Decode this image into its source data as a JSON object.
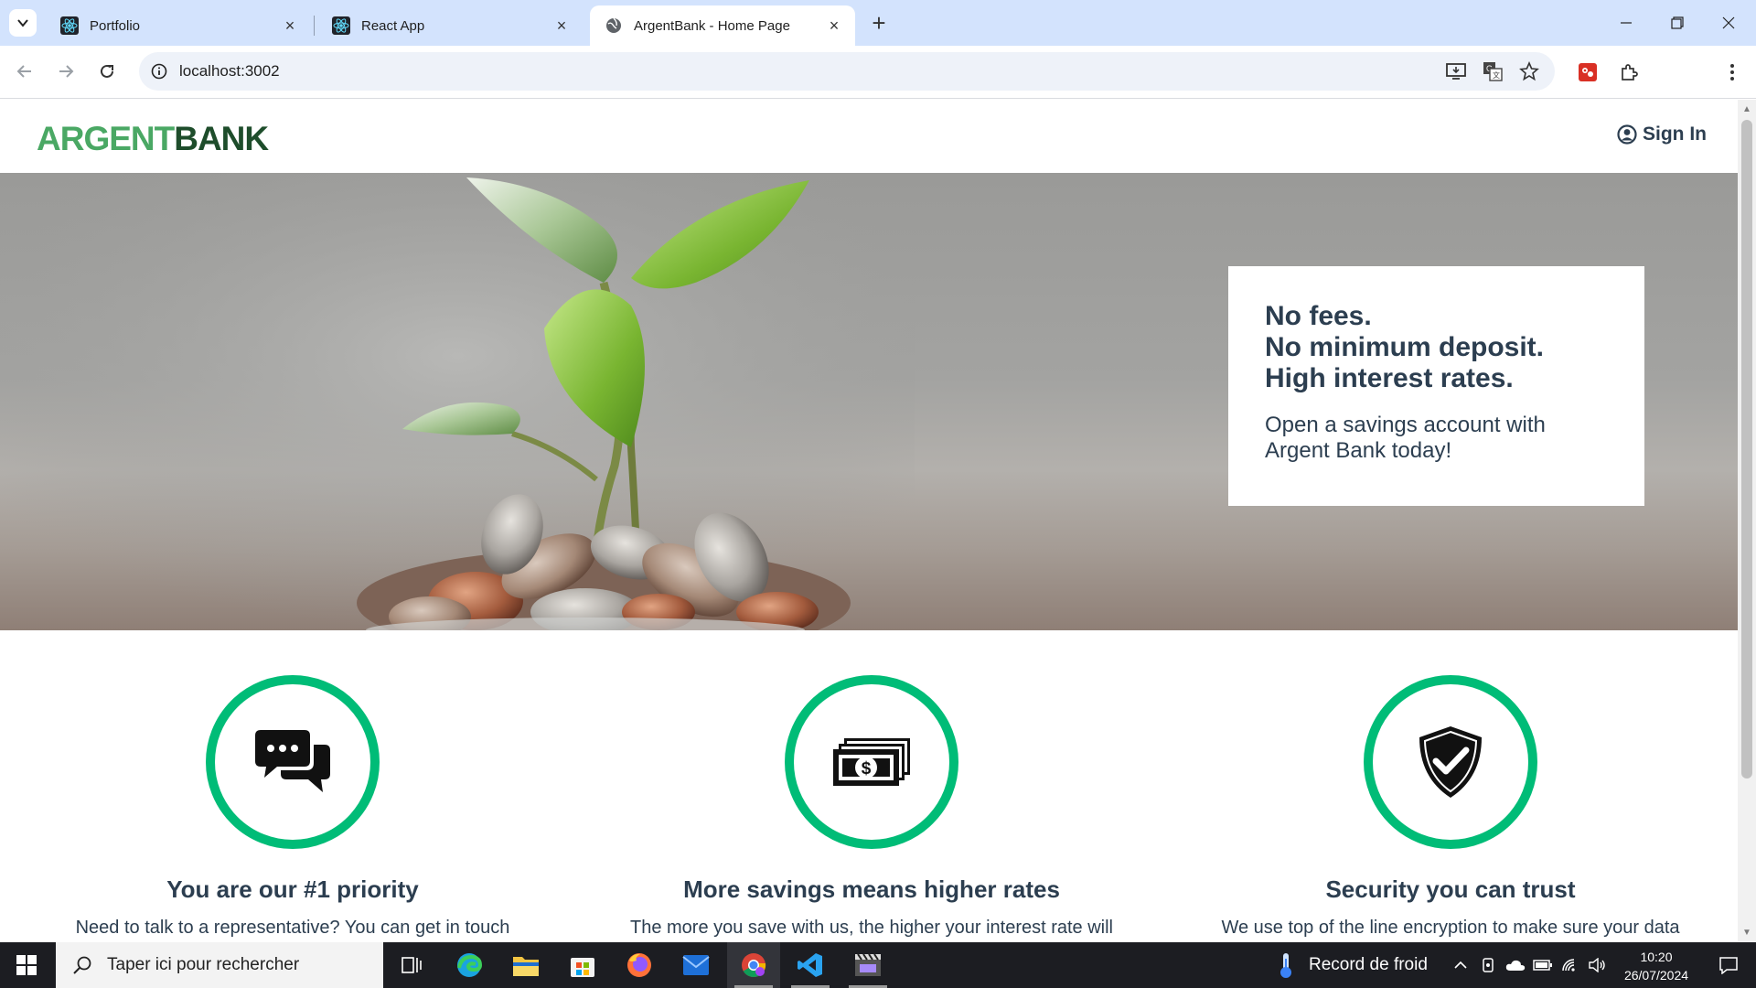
{
  "browser": {
    "tabs": [
      {
        "title": "Portfolio",
        "favicon": "react-icon",
        "close": "×"
      },
      {
        "title": "React App",
        "favicon": "react-icon",
        "close": "×"
      },
      {
        "title": "ArgentBank - Home Page",
        "favicon": "globe-icon",
        "close": "×",
        "active": true
      }
    ],
    "new_tab": "+",
    "address": "localhost:3002"
  },
  "site": {
    "logo_part1": "ARGENT",
    "logo_part2": "BANK",
    "sign_in": "Sign In",
    "hero": {
      "subtitles": [
        "No fees.",
        "No minimum deposit.",
        "High interest rates."
      ],
      "text_line1": "Open a savings account with",
      "text_line2": "Argent Bank today!"
    },
    "features": [
      {
        "icon": "chat-icon",
        "title": "You are our #1 priority",
        "text": "Need to talk to a representative? You can get in touch"
      },
      {
        "icon": "money-icon",
        "title": "More savings means higher rates",
        "text": "The more you save with us, the higher your interest rate will"
      },
      {
        "icon": "security-icon",
        "title": "Security you can trust",
        "text": "We use top of the line encryption to make sure your data"
      }
    ]
  },
  "taskbar": {
    "search_placeholder": "Taper ici pour rechercher",
    "weather": "Record de froid",
    "time": "10:20",
    "date": "26/07/2024"
  },
  "colors": {
    "accent_green": "#00bc77",
    "logo_light": "#4aa864",
    "logo_dark": "#1e4d2b",
    "text_dark": "#2c3e50",
    "tab_strip": "#d3e3fd"
  }
}
